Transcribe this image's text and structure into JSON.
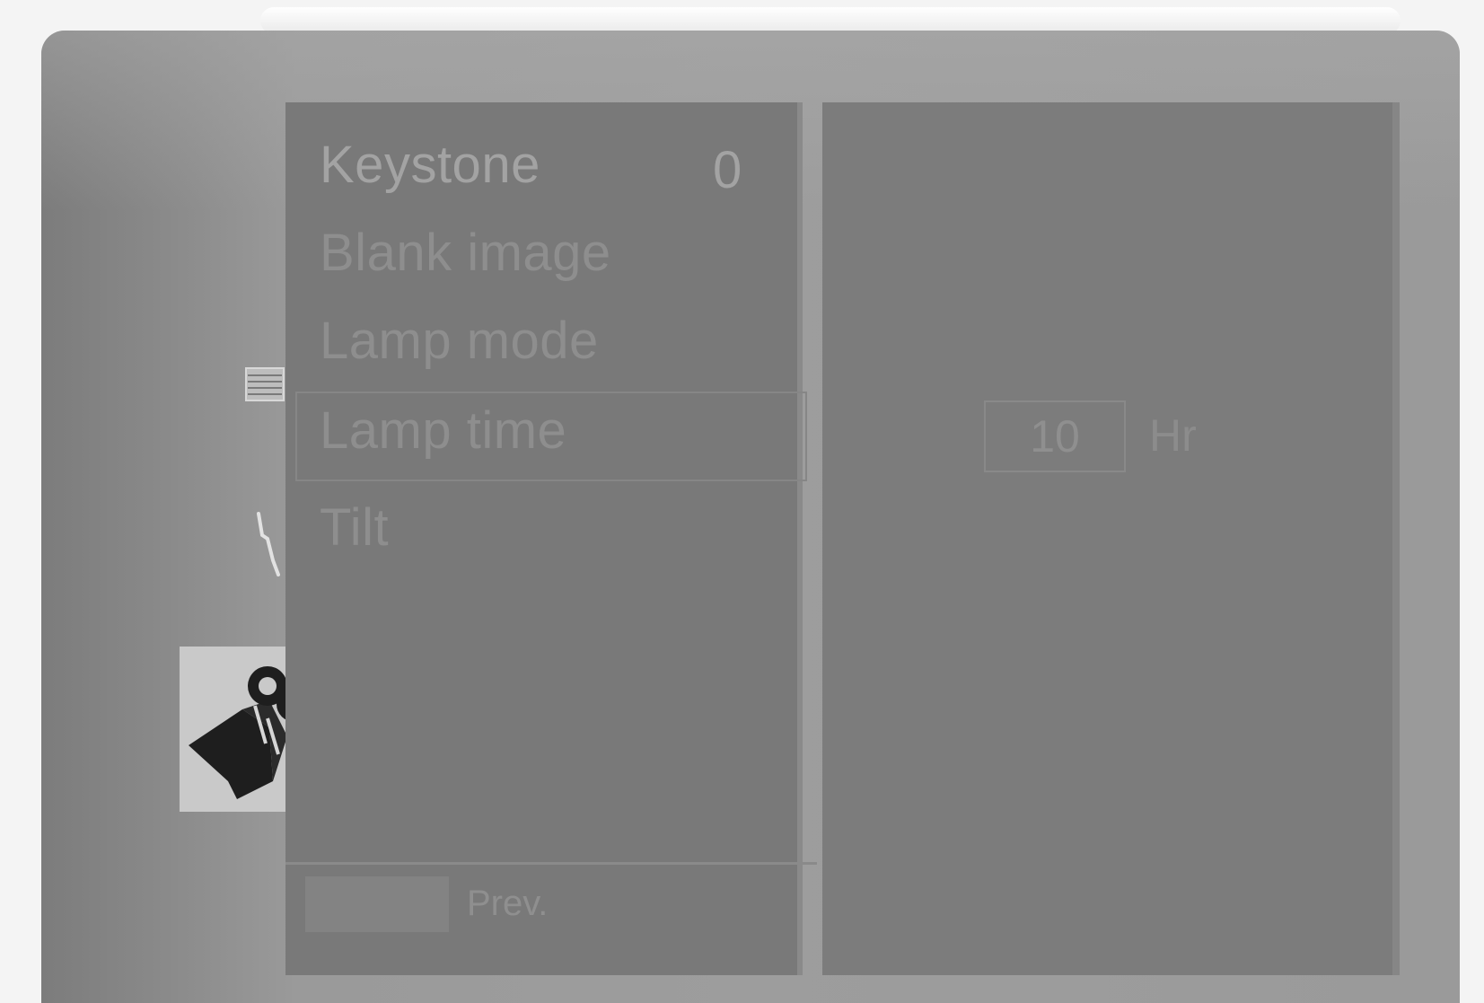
{
  "menu": {
    "items": [
      {
        "label": "Keystone",
        "value": "0"
      },
      {
        "label": "Blank image",
        "value": ""
      },
      {
        "label": "Lamp mode",
        "value": ""
      },
      {
        "label": "Lamp time",
        "value": ""
      },
      {
        "label": "Tilt",
        "value": ""
      }
    ],
    "selected_index": 3
  },
  "footer": {
    "prev_label": "Prev."
  },
  "detail": {
    "lamp_time_value": "10",
    "lamp_time_unit": "Hr"
  },
  "icons": {
    "picture": "picture-menu-icon",
    "audio": "audio-menu-icon",
    "special": "projector-setup-icon"
  },
  "colors": {
    "panel": "#797979",
    "frame": "#9d9d9d",
    "text": "#8e8e8e",
    "selected_tile": "#c9c9c9"
  }
}
